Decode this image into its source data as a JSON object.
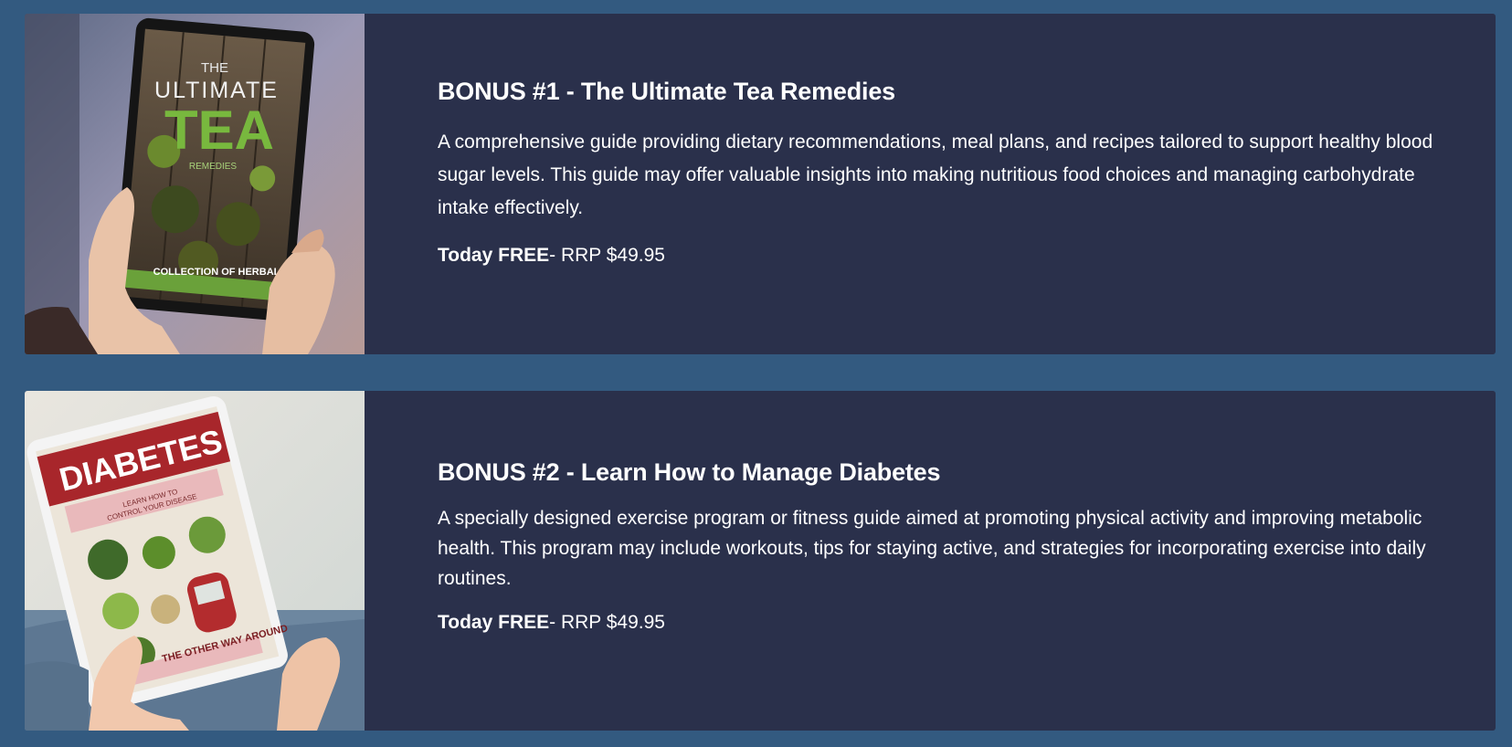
{
  "bonuses": [
    {
      "title": "BONUS #1 - The Ultimate Tea Remedies",
      "description": "A comprehensive guide providing dietary recommendations, meal plans, and recipes tailored to support healthy blood sugar levels. This guide may offer valuable insights into making nutritious food choices and managing carbohydrate intake effectively.",
      "price_label": "Today FREE",
      "price_suffix": "- RRP $49.95",
      "cover": {
        "line1": "THE",
        "line2": "ULTIMATE",
        "line3": "TEA",
        "line4": "REMEDIES",
        "line5": "COLLECTION OF HERBAL"
      }
    },
    {
      "title": "BONUS #2 - Learn How to Manage Diabetes",
      "description": "A specially designed exercise program or fitness guide aimed at promoting physical activity and improving metabolic health. This program may include workouts, tips for staying active, and strategies for incorporating exercise into daily routines.",
      "price_label": "Today FREE",
      "price_suffix": "- RRP $49.95",
      "cover": {
        "line1": "DIABETES",
        "line2": "LEARN HOW TO",
        "line3": "CONTROL YOUR DISEASE",
        "line4": "THE OTHER WAY AROUND"
      }
    }
  ],
  "colors": {
    "page_background": "#335a80",
    "card_background": "#2a304b",
    "text": "#ffffff"
  }
}
